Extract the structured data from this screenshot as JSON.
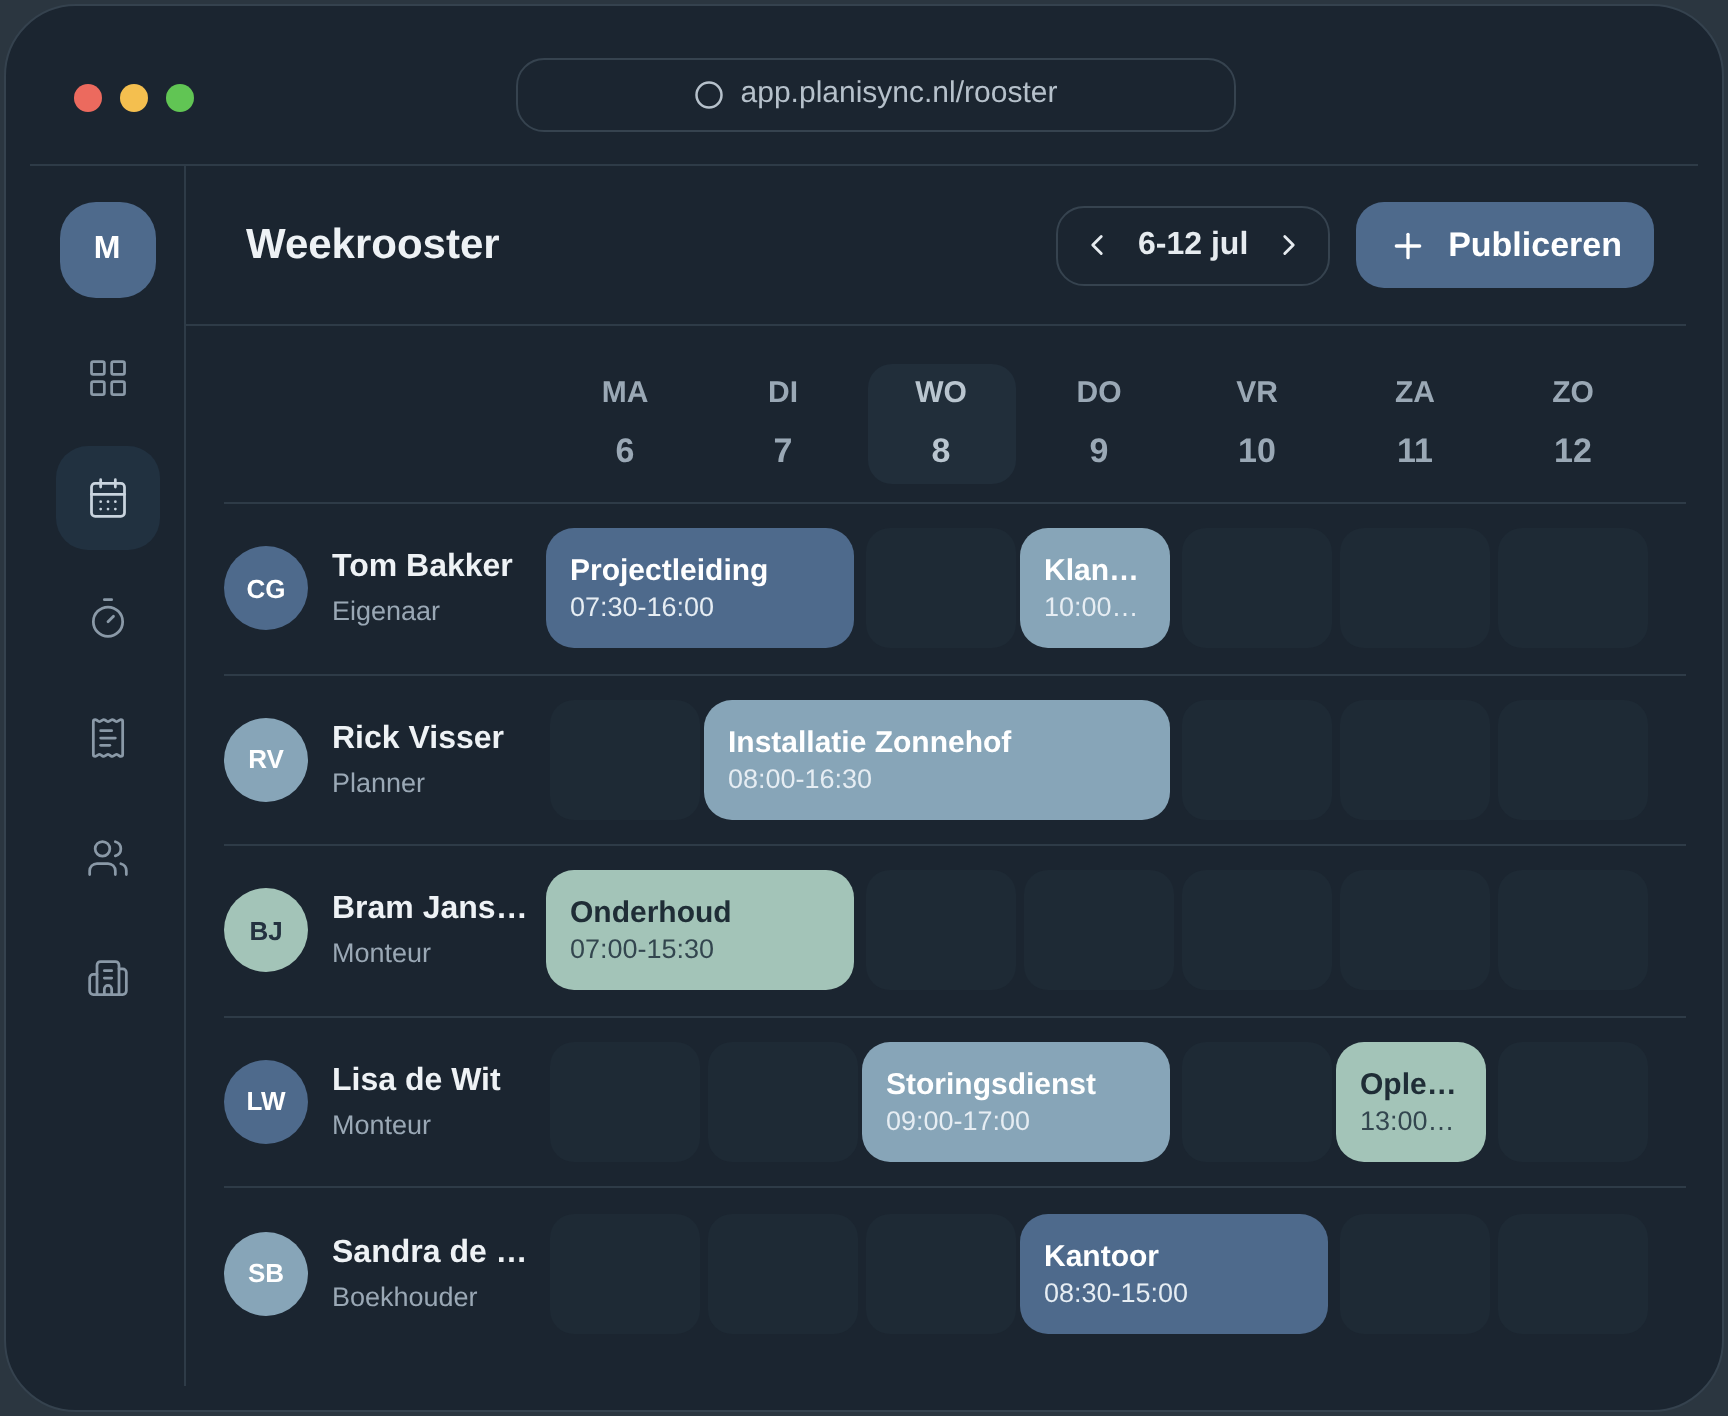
{
  "browser": {
    "url": "app.planisync.nl/rooster"
  },
  "sidebar": {
    "avatar": "M",
    "items": [
      {
        "kind": "grid",
        "selected": false
      },
      {
        "kind": "calendar",
        "selected": true
      },
      {
        "kind": "timer",
        "selected": false
      },
      {
        "kind": "receipt",
        "selected": false
      },
      {
        "kind": "users",
        "selected": false
      },
      {
        "kind": "building",
        "selected": false
      }
    ]
  },
  "header": {
    "title": "Weekrooster",
    "date_range": "6-12 jul",
    "publish_button": "Publiceren"
  },
  "days": [
    {
      "label": "MA",
      "date": "6",
      "selected": false
    },
    {
      "label": "DI",
      "date": "7",
      "selected": false
    },
    {
      "label": "WO",
      "date": "8",
      "selected": true
    },
    {
      "label": "DO",
      "date": "9",
      "selected": false
    },
    {
      "label": "VR",
      "date": "10",
      "selected": false
    },
    {
      "label": "ZA",
      "date": "11",
      "selected": false
    },
    {
      "label": "ZO",
      "date": "12",
      "selected": false
    }
  ],
  "rows": [
    {
      "initials": "CG",
      "color": "#4e6a8c",
      "name": "Tom Bakker",
      "role": "Eigenaar",
      "cells": [
        {
          "kind": "twoday",
          "title": "Projectleiding",
          "time": "07:30-16:00",
          "color": "#4e6a8c"
        },
        {
          "kind": "empty"
        },
        {
          "kind": "oneday",
          "title": "Klan…",
          "time": "10:00…",
          "color": "#87a5b8"
        },
        {
          "kind": "empty"
        },
        {
          "kind": "empty"
        },
        {
          "kind": "empty"
        }
      ]
    },
    {
      "initials": "RV",
      "color": "#87a5b8",
      "name": "Rick Visser",
      "role": "Planner",
      "cells": [
        {
          "kind": "empty"
        },
        {
          "kind": "threeday",
          "title": "Installatie Zonnehof",
          "time": "08:00-16:30",
          "color": "#87a5b8"
        },
        {
          "kind": "empty"
        },
        {
          "kind": "empty"
        },
        {
          "kind": "empty"
        }
      ]
    },
    {
      "initials": "BJ",
      "color": "#a3c4b8",
      "name": "Bram Jans…",
      "role": "Monteur",
      "cells": [
        {
          "kind": "twoday",
          "title": "Onderhoud",
          "time": "07:00-15:30",
          "color": "#a3c4b8"
        },
        {
          "kind": "empty"
        },
        {
          "kind": "empty"
        },
        {
          "kind": "empty"
        },
        {
          "kind": "empty"
        },
        {
          "kind": "empty"
        }
      ]
    },
    {
      "initials": "LW",
      "color": "#4e6a8c",
      "name": "Lisa de Wit",
      "role": "Monteur",
      "cells": [
        {
          "kind": "empty"
        },
        {
          "kind": "empty"
        },
        {
          "kind": "twoday",
          "title": "Storingsdienst",
          "time": "09:00-17:00",
          "color": "#87a5b8"
        },
        {
          "kind": "empty"
        },
        {
          "kind": "oneday",
          "title": "Ople…",
          "time": "13:00…",
          "color": "#a3c4b8"
        },
        {
          "kind": "empty"
        }
      ]
    },
    {
      "initials": "SB",
      "color": "#87a5b8",
      "name": "Sandra de …",
      "role": "Boekhouder",
      "cells": [
        {
          "kind": "empty"
        },
        {
          "kind": "empty"
        },
        {
          "kind": "empty"
        },
        {
          "kind": "twoday",
          "title": "Kantoor",
          "time": "08:30-15:00",
          "color": "#4e6a8c"
        },
        {
          "kind": "empty"
        },
        {
          "kind": "empty"
        }
      ]
    }
  ]
}
